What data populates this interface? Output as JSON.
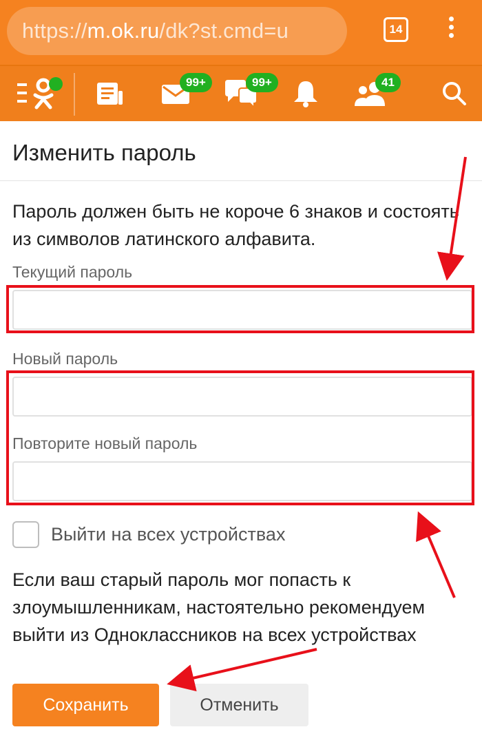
{
  "browser": {
    "url_prefix": "https://",
    "url_domain": "m.ok.ru",
    "url_path": "/dk?st.cmd=u",
    "tab_count": "14"
  },
  "nav": {
    "badges": {
      "messages": "99+",
      "discussions": "99+",
      "friends": "41"
    },
    "icons": [
      "menu-logo-icon",
      "feed-icon",
      "mail-icon",
      "discussions-icon",
      "bell-icon",
      "friends-icon",
      "search-icon"
    ]
  },
  "page": {
    "title": "Изменить пароль",
    "description": "Пароль должен быть не короче 6 знаков и состоять из символов латинского алфавита.",
    "fields": {
      "current_label": "Текущий пароль",
      "current_value": "",
      "new_label": "Новый пароль",
      "new_value": "",
      "repeat_label": "Повторите новый пароль",
      "repeat_value": ""
    },
    "logout_all": {
      "label": "Выйти на всех устройствах",
      "checked": false
    },
    "warning": "Если ваш старый пароль мог попасть к злоумышленникам, настоятельно рекомендуем выйти из Одноклассников на всех устройствах",
    "buttons": {
      "save": "Сохранить",
      "cancel": "Отменить"
    }
  },
  "colors": {
    "brand_orange": "#f58220",
    "badge_green": "#21b021",
    "annotation_red": "#e8101a"
  }
}
